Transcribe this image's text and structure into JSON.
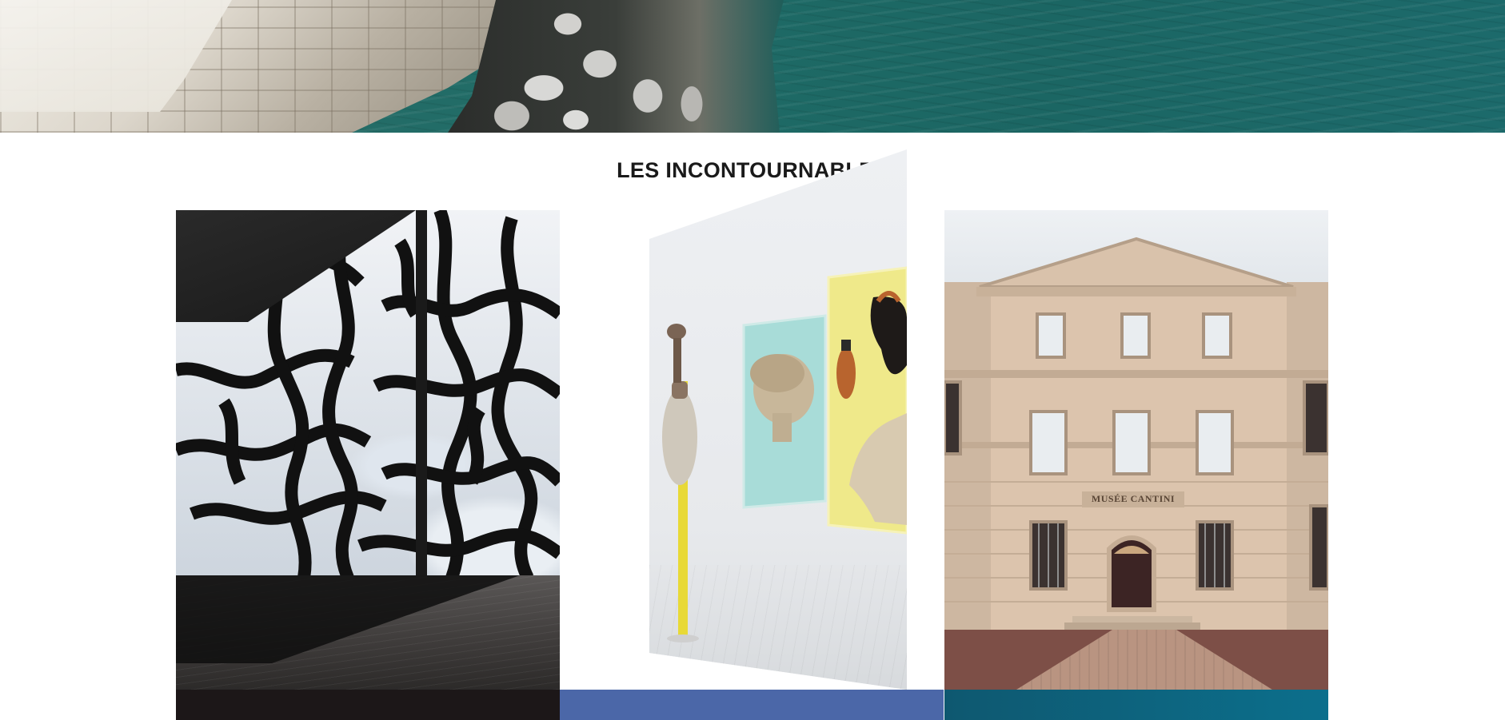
{
  "hero": {
    "image": "marseille-fort-and-sea-banner"
  },
  "section": {
    "title": "LES INCONTOURNABLES"
  },
  "cards": [
    {
      "image": "mucem-lattice-facade",
      "band_color": "#1c1718"
    },
    {
      "image": "gallery-antiquities-exhibition",
      "band_color": "#4b67a8"
    },
    {
      "image": "musee-cantini-facade",
      "sign_text": "MUSÉE CANTINI",
      "band_color": "#0c6f8c"
    }
  ],
  "colors": {
    "title": "#1a1a1a",
    "background": "#ffffff",
    "sea": "#1f6b66"
  }
}
